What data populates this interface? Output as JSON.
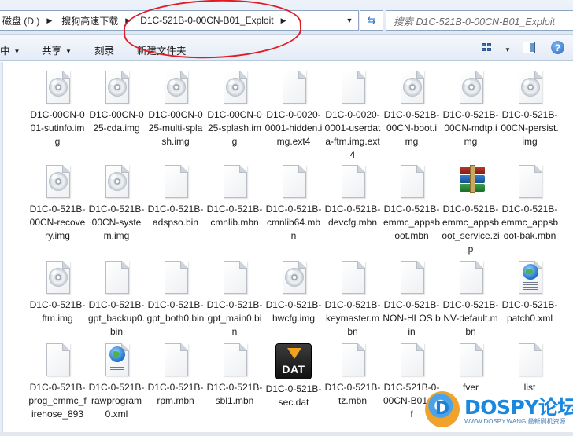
{
  "address_bar": {
    "crumbs": [
      "磁盘 (D:)",
      "搜狗高速下载",
      "D1C-521B-0-00CN-B01_Exploit"
    ],
    "search_placeholder": "搜索 D1C-521B-0-00CN-B01_Exploit"
  },
  "toolbar": {
    "organize_label": "中",
    "share_label": "共享",
    "burn_label": "刻录",
    "new_folder_label": "新建文件夹"
  },
  "files": [
    {
      "name": "D1C-00CN-001-sutinfo.img",
      "icon": "disc-image-icon"
    },
    {
      "name": "D1C-00CN-025-cda.img",
      "icon": "disc-image-icon"
    },
    {
      "name": "D1C-00CN-025-multi-splash.img",
      "icon": "disc-image-icon"
    },
    {
      "name": "D1C-00CN-025-splash.img",
      "icon": "disc-image-icon"
    },
    {
      "name": "D1C-0-0020-0001-hidden.img.ext4",
      "icon": "blank-file-icon"
    },
    {
      "name": "D1C-0-0020-0001-userdata-ftm.img.ext4",
      "icon": "blank-file-icon"
    },
    {
      "name": "D1C-0-521B-00CN-boot.img",
      "icon": "disc-image-icon"
    },
    {
      "name": "D1C-0-521B-00CN-mdtp.img",
      "icon": "disc-image-icon"
    },
    {
      "name": "D1C-0-521B-00CN-persist.img",
      "icon": "disc-image-icon"
    },
    {
      "name": "D1C-0-521B-00CN-recovery.img",
      "icon": "disc-image-icon"
    },
    {
      "name": "D1C-0-521B-00CN-system.img",
      "icon": "disc-image-icon"
    },
    {
      "name": "D1C-0-521B-adspso.bin",
      "icon": "blank-file-icon"
    },
    {
      "name": "D1C-0-521B-cmnlib.mbn",
      "icon": "blank-file-icon"
    },
    {
      "name": "D1C-0-521B-cmnlib64.mbn",
      "icon": "blank-file-icon"
    },
    {
      "name": "D1C-0-521B-devcfg.mbn",
      "icon": "blank-file-icon"
    },
    {
      "name": "D1C-0-521B-emmc_appsboot.mbn",
      "icon": "blank-file-icon"
    },
    {
      "name": "D1C-0-521B-emmc_appsboot_service.zip",
      "icon": "winrar-archive-icon"
    },
    {
      "name": "D1C-0-521B-emmc_appsboot-bak.mbn",
      "icon": "blank-file-icon"
    },
    {
      "name": "D1C-0-521B-ftm.img",
      "icon": "disc-image-icon"
    },
    {
      "name": "D1C-0-521B-gpt_backup0.bin",
      "icon": "blank-file-icon"
    },
    {
      "name": "D1C-0-521B-gpt_both0.bin",
      "icon": "blank-file-icon"
    },
    {
      "name": "D1C-0-521B-gpt_main0.bin",
      "icon": "blank-file-icon"
    },
    {
      "name": "D1C-0-521B-hwcfg.img",
      "icon": "disc-image-icon"
    },
    {
      "name": "D1C-0-521B-keymaster.mbn",
      "icon": "blank-file-icon"
    },
    {
      "name": "D1C-0-521B-NON-HLOS.bin",
      "icon": "blank-file-icon"
    },
    {
      "name": "D1C-0-521B-NV-default.mbn",
      "icon": "blank-file-icon"
    },
    {
      "name": "D1C-0-521B-patch0.xml",
      "icon": "xml-file-icon"
    },
    {
      "name": "D1C-0-521B-prog_emmc_firehose_893",
      "icon": "blank-file-icon"
    },
    {
      "name": "D1C-0-521B-rawprogram0.xml",
      "icon": "xml-file-icon"
    },
    {
      "name": "D1C-0-521B-rpm.mbn",
      "icon": "blank-file-icon"
    },
    {
      "name": "D1C-0-521B-sbl1.mbn",
      "icon": "blank-file-icon"
    },
    {
      "name": "D1C-0-521B-sec.dat",
      "icon": "dat-file-icon"
    },
    {
      "name": "D1C-0-521B-tz.mbn",
      "icon": "blank-file-icon"
    },
    {
      "name": "D1C-521B-0-00CN-B01.mlf",
      "icon": "blank-file-icon"
    },
    {
      "name": "fver",
      "icon": "blank-file-icon"
    },
    {
      "name": "list",
      "icon": "blank-file-icon"
    }
  ],
  "watermark": {
    "title": "DOSPY论坛",
    "url": "WWW.DOSPY.WANG 最新刷机资源"
  },
  "colors": {
    "annotation": "#e01b24",
    "toolbar_top": "#f5f8fc",
    "brand": "#1a88de"
  }
}
